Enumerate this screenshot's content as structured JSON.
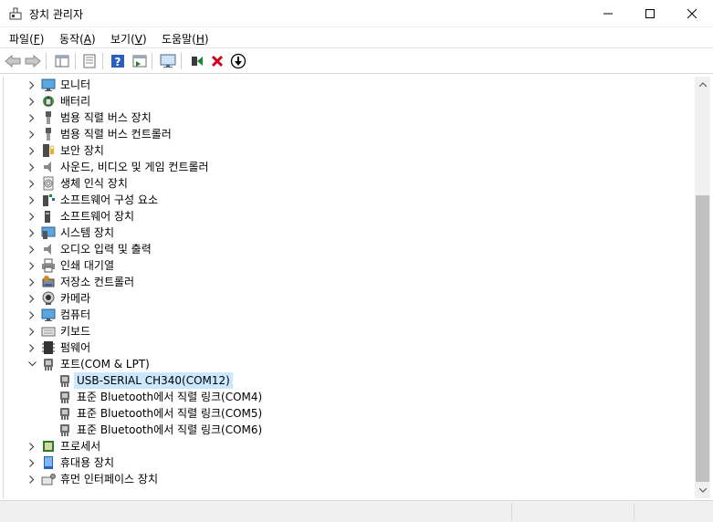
{
  "window": {
    "title": "장치 관리자",
    "icon": "device-manager-icon"
  },
  "menu": [
    {
      "label": "파일",
      "key": "F"
    },
    {
      "label": "동작",
      "key": "A"
    },
    {
      "label": "보기",
      "key": "V"
    },
    {
      "label": "도움말",
      "key": "H"
    }
  ],
  "toolbar": [
    "back-arrow-icon",
    "forward-arrow-icon",
    "show-hide-console-tree-icon",
    "properties-icon",
    "help-icon",
    "action-pane-icon",
    "scan-hardware-icon",
    "enable-device-icon",
    "uninstall-device-icon",
    "update-driver-icon"
  ],
  "tree": {
    "categories": [
      {
        "label": "모니터",
        "icon": "monitor-icon",
        "expanded": false
      },
      {
        "label": "배터리",
        "icon": "battery-icon",
        "expanded": false
      },
      {
        "label": "범용 직렬 버스 장치",
        "icon": "usb-device-icon",
        "expanded": false
      },
      {
        "label": "범용 직렬 버스 컨트롤러",
        "icon": "usb-controller-icon",
        "expanded": false
      },
      {
        "label": "보안 장치",
        "icon": "security-device-icon",
        "expanded": false
      },
      {
        "label": "사운드, 비디오 및 게임 컨트롤러",
        "icon": "speaker-icon",
        "expanded": false
      },
      {
        "label": "생체 인식 장치",
        "icon": "fingerprint-icon",
        "expanded": false
      },
      {
        "label": "소프트웨어 구성 요소",
        "icon": "software-component-icon",
        "expanded": false
      },
      {
        "label": "소프트웨어 장치",
        "icon": "software-device-icon",
        "expanded": false
      },
      {
        "label": "시스템 장치",
        "icon": "system-device-icon",
        "expanded": false
      },
      {
        "label": "오디오 입력 및 출력",
        "icon": "audio-io-icon",
        "expanded": false
      },
      {
        "label": "인쇄 대기열",
        "icon": "printer-icon",
        "expanded": false
      },
      {
        "label": "저장소 컨트롤러",
        "icon": "storage-controller-icon",
        "expanded": false
      },
      {
        "label": "카메라",
        "icon": "camera-icon",
        "expanded": false
      },
      {
        "label": "컴퓨터",
        "icon": "computer-icon",
        "expanded": false
      },
      {
        "label": "키보드",
        "icon": "keyboard-icon",
        "expanded": false
      },
      {
        "label": "펌웨어",
        "icon": "firmware-icon",
        "expanded": false
      },
      {
        "label": "포트(COM & LPT)",
        "icon": "port-icon",
        "expanded": true,
        "children": [
          {
            "label": "USB-SERIAL CH340(COM12)",
            "icon": "port-icon",
            "selected": true
          },
          {
            "label": "표준 Bluetooth에서 직렬 링크(COM4)",
            "icon": "port-icon",
            "selected": false
          },
          {
            "label": "표준 Bluetooth에서 직렬 링크(COM5)",
            "icon": "port-icon",
            "selected": false
          },
          {
            "label": "표준 Bluetooth에서 직렬 링크(COM6)",
            "icon": "port-icon",
            "selected": false
          }
        ]
      },
      {
        "label": "프로세서",
        "icon": "processor-icon",
        "expanded": false
      },
      {
        "label": "휴대용 장치",
        "icon": "portable-device-icon",
        "expanded": false
      },
      {
        "label": "휴먼 인터페이스 장치",
        "icon": "hid-icon",
        "expanded": false
      }
    ]
  },
  "colors": {
    "selection": "#cce8ff",
    "accent_red": "#d0021b",
    "accent_green": "#1b8a2e",
    "accent_blue": "#1f5fbf"
  }
}
